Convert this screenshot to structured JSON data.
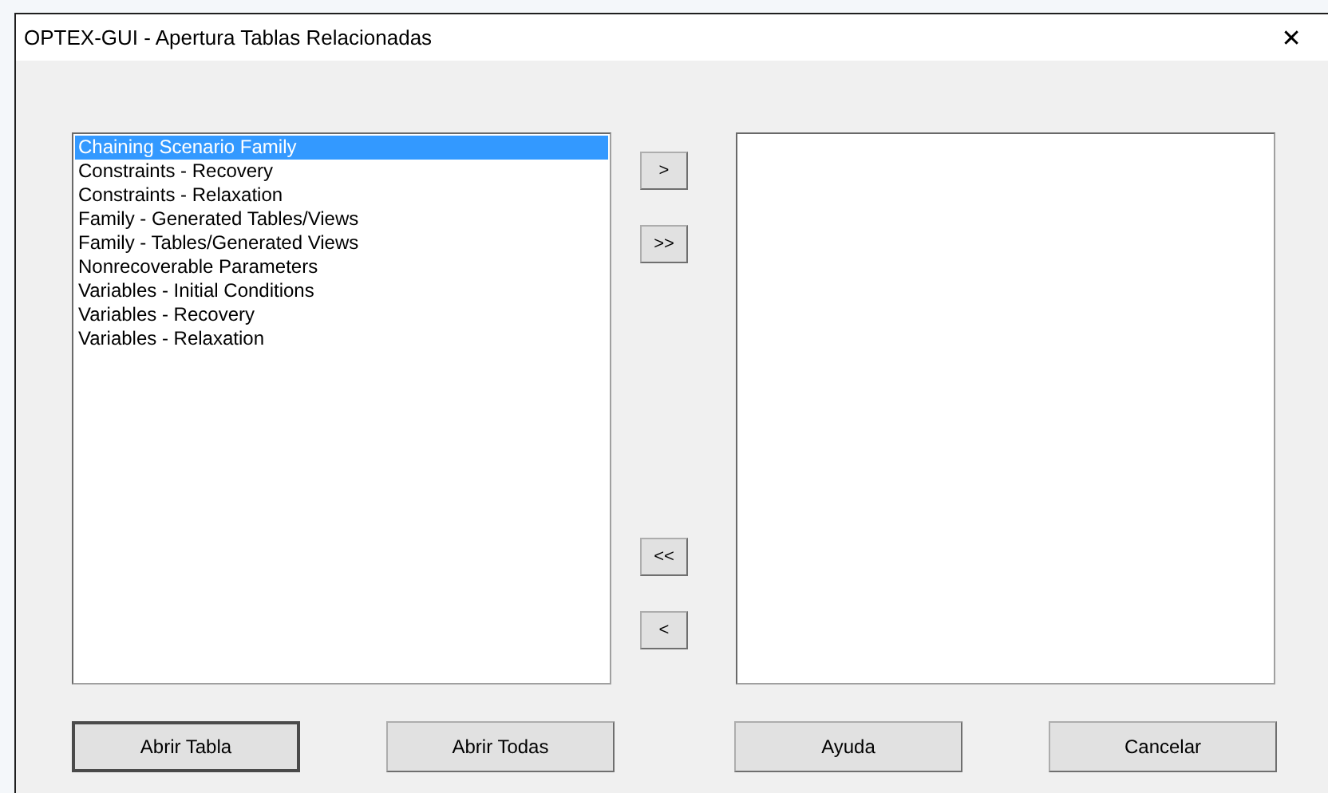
{
  "window": {
    "title": "OPTEX-GUI  -  Apertura Tablas Relacionadas",
    "close": "✕"
  },
  "available_list": [
    {
      "label": "Chaining Scenario Family",
      "selected": true
    },
    {
      "label": "Constraints - Recovery",
      "selected": false
    },
    {
      "label": "Constraints - Relaxation",
      "selected": false
    },
    {
      "label": "Family - Generated Tables/Views",
      "selected": false
    },
    {
      "label": "Family - Tables/Generated Views",
      "selected": false
    },
    {
      "label": "Nonrecoverable Parameters",
      "selected": false
    },
    {
      "label": "Variables - Initial Conditions",
      "selected": false
    },
    {
      "label": "Variables - Recovery",
      "selected": false
    },
    {
      "label": "Variables - Relaxation",
      "selected": false
    }
  ],
  "transfer_buttons": [
    {
      "label": ">",
      "kind": "top"
    },
    {
      "label": ">>",
      "kind": "top"
    },
    {
      "label": "<<",
      "kind": "bottom"
    },
    {
      "label": "<",
      "kind": "bottom"
    }
  ],
  "buttons": [
    {
      "label": "Abrir Tabla",
      "default": true
    },
    {
      "label": "Abrir Todas",
      "default": false
    },
    {
      "label": "Ayuda",
      "default": false
    },
    {
      "label": "Cancelar",
      "default": false
    }
  ]
}
